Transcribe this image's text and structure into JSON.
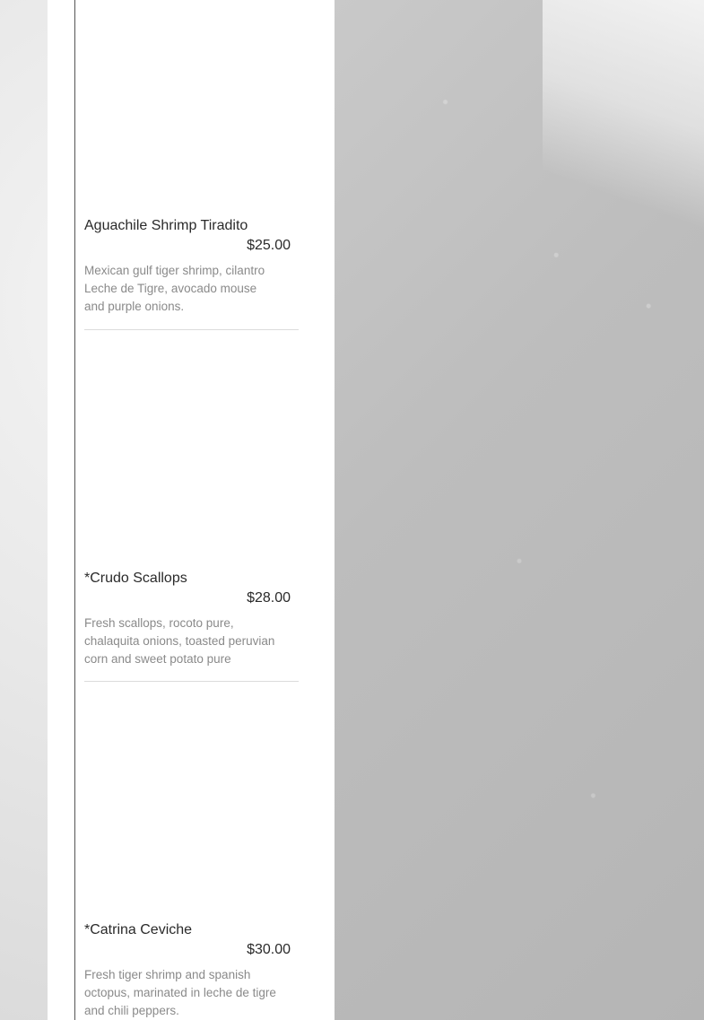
{
  "menu": {
    "items": [
      {
        "name": "Aguachile Shrimp Tiradito",
        "price": "$25.00",
        "description": "Mexican gulf tiger shrimp, cilantro Leche de Tigre, avocado mouse and purple onions."
      },
      {
        "name": "*Crudo Scallops",
        "price": "$28.00",
        "description": "Fresh scallops, rocoto pure, chalaquita onions, toasted peruvian corn and sweet potato pure"
      },
      {
        "name": "*Catrina Ceviche",
        "price": "$30.00",
        "description": "Fresh tiger shrimp and spanish octopus, marinated in leche de tigre and chili peppers."
      }
    ]
  }
}
